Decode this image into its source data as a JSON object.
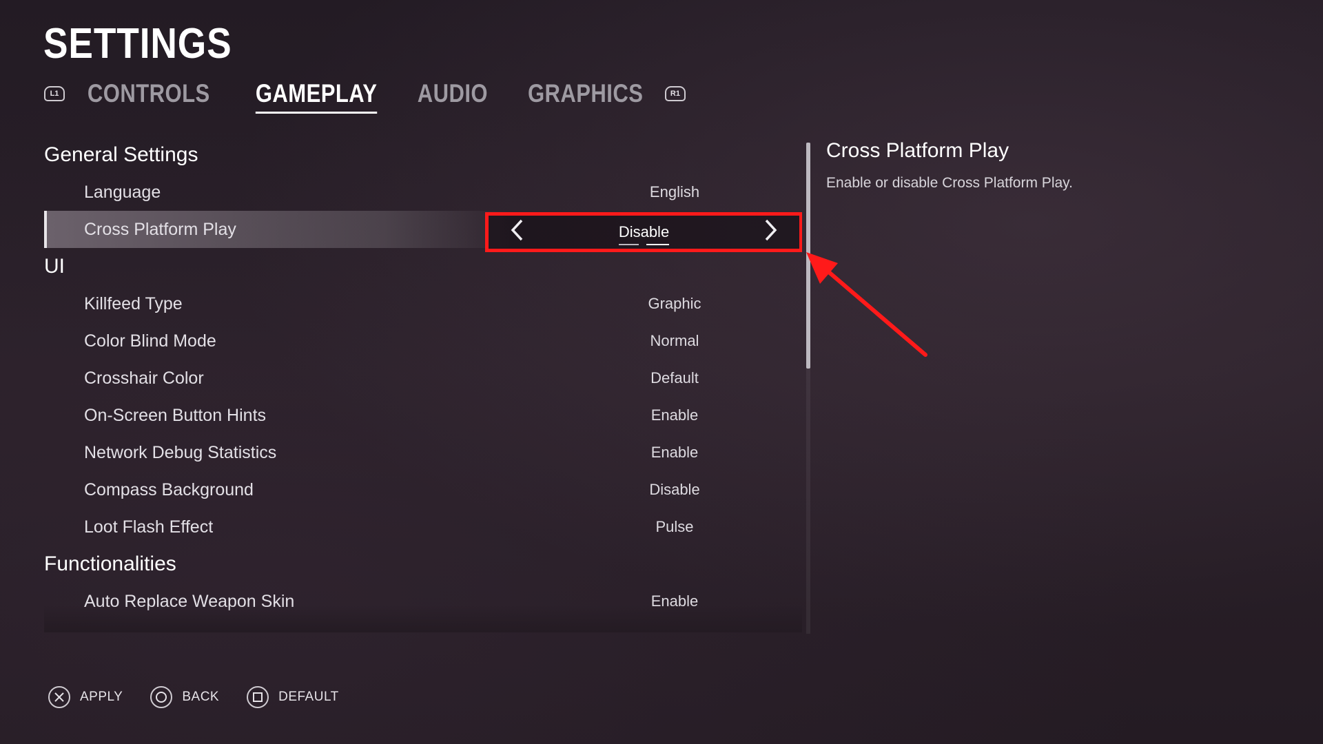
{
  "header": {
    "title": "SETTINGS",
    "left_bumper": "L1",
    "right_bumper": "R1",
    "tabs": [
      {
        "label": "CONTROLS",
        "active": false
      },
      {
        "label": "GAMEPLAY",
        "active": true
      },
      {
        "label": "AUDIO",
        "active": false
      },
      {
        "label": "GRAPHICS",
        "active": false
      }
    ]
  },
  "settings": {
    "general": {
      "heading": "General Settings",
      "rows": [
        {
          "label": "Language",
          "value": "English"
        },
        {
          "label": "Cross Platform Play",
          "value": "Disable",
          "selected": true
        }
      ]
    },
    "ui": {
      "heading": "UI",
      "rows": [
        {
          "label": "Killfeed Type",
          "value": "Graphic"
        },
        {
          "label": "Color Blind Mode",
          "value": "Normal"
        },
        {
          "label": "Crosshair Color",
          "value": "Default"
        },
        {
          "label": "On-Screen Button Hints",
          "value": "Enable"
        },
        {
          "label": "Network Debug Statistics",
          "value": "Enable"
        },
        {
          "label": "Compass Background",
          "value": "Disable"
        },
        {
          "label": "Loot Flash Effect",
          "value": "Pulse"
        }
      ]
    },
    "functionalities": {
      "heading": "Functionalities",
      "rows": [
        {
          "label": "Auto Replace Weapon Skin",
          "value": "Enable"
        }
      ]
    }
  },
  "scroll": {
    "position": 0.0,
    "visible_fraction": 0.46
  },
  "detail": {
    "title": "Cross Platform Play",
    "description": "Enable or disable Cross Platform Play."
  },
  "footer": {
    "apply": "APPLY",
    "back": "BACK",
    "default": "DEFAULT"
  },
  "colors": {
    "highlight_border": "#ff1a1a",
    "annotation_arrow": "#ff1a1a",
    "background": "#241b23"
  },
  "icons": {
    "apply": "cross-button-icon",
    "back": "circle-button-icon",
    "default": "square-button-icon",
    "prev": "chevron-left-icon",
    "next": "chevron-right-icon"
  }
}
